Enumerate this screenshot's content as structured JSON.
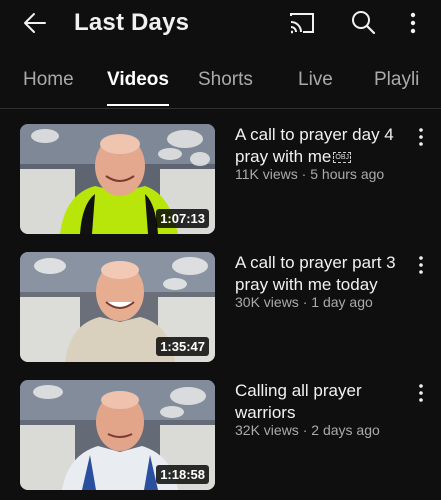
{
  "header": {
    "title": "Last Days",
    "icons": [
      "back-arrow-icon",
      "cast-icon",
      "search-icon",
      "more-vert-icon"
    ]
  },
  "tabs": [
    {
      "label": "Home",
      "active": false
    },
    {
      "label": "Videos",
      "active": true
    },
    {
      "label": "Shorts",
      "active": false
    },
    {
      "label": "Live",
      "active": false
    },
    {
      "label": "Playli",
      "active": false
    }
  ],
  "videos": [
    {
      "title": "A call to prayer day 4 pray with me",
      "badge": "OBJ",
      "views": "11K views",
      "age": "5 hours ago",
      "duration": "1:07:13",
      "shirt_color": "#b8e60a"
    },
    {
      "title": "A call to prayer part 3 pray with me today",
      "views": "30K views",
      "age": "1 day ago",
      "duration": "1:35:47",
      "shirt_color": "#d9d1bd"
    },
    {
      "title": "Calling all prayer warriors",
      "views": "32K views",
      "age": "2 days ago",
      "duration": "1:18:58",
      "shirt_color": "#e9edf2"
    }
  ],
  "colors": {
    "background": "#0f0f0f",
    "text_primary": "#f1f1f1",
    "text_secondary": "#aaaaaa"
  }
}
